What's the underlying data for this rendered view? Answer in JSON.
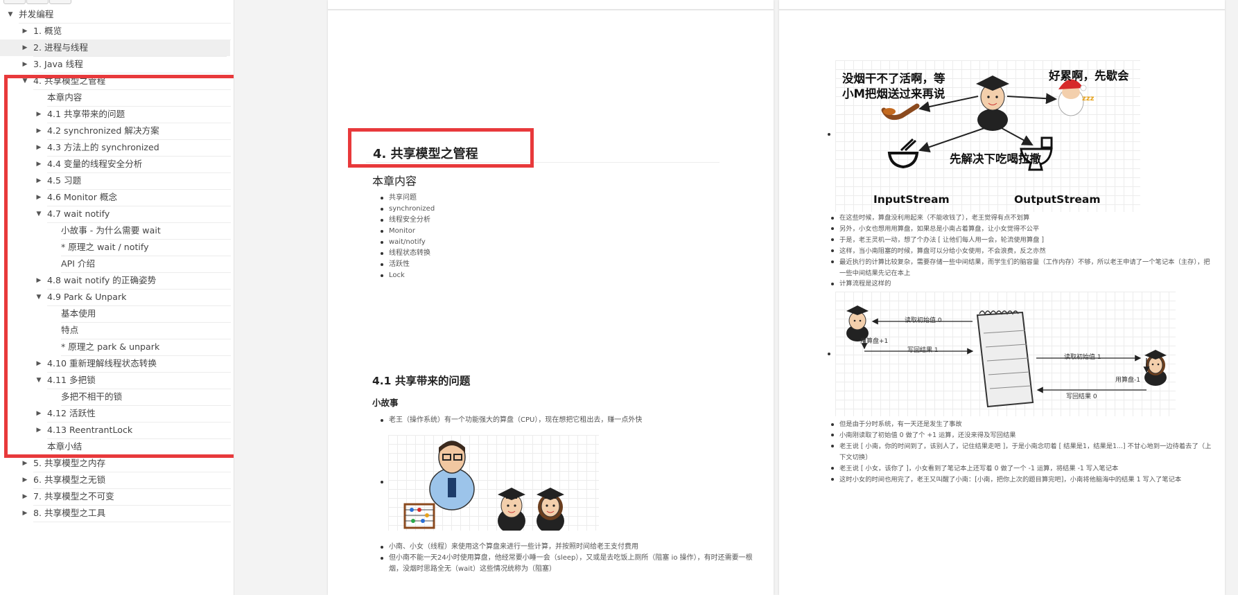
{
  "sidebar": {
    "items": [
      {
        "label": "并发编程",
        "indent": 0,
        "toggle": "▼",
        "interactable": true
      },
      {
        "label": "1. 概览",
        "indent": 1,
        "toggle": "▶",
        "interactable": true
      },
      {
        "label": "2. 进程与线程",
        "indent": 1,
        "toggle": "▶",
        "interactable": true,
        "selected": true
      },
      {
        "label": "3. Java 线程",
        "indent": 1,
        "toggle": "▶",
        "interactable": true
      },
      {
        "label": "4. 共享模型之管程",
        "indent": 1,
        "toggle": "▼",
        "interactable": true
      },
      {
        "label": "本章内容",
        "indent": 2,
        "toggle": "",
        "interactable": true
      },
      {
        "label": "4.1 共享带来的问题",
        "indent": 2,
        "toggle": "▶",
        "interactable": true
      },
      {
        "label": "4.2 synchronized 解决方案",
        "indent": 2,
        "toggle": "▶",
        "interactable": true
      },
      {
        "label": "4.3 方法上的 synchronized",
        "indent": 2,
        "toggle": "▶",
        "interactable": true
      },
      {
        "label": "4.4 变量的线程安全分析",
        "indent": 2,
        "toggle": "▶",
        "interactable": true
      },
      {
        "label": "4.5 习题",
        "indent": 2,
        "toggle": "▶",
        "interactable": true
      },
      {
        "label": "4.6 Monitor 概念",
        "indent": 2,
        "toggle": "▶",
        "interactable": true
      },
      {
        "label": "4.7 wait notify",
        "indent": 2,
        "toggle": "▼",
        "interactable": true
      },
      {
        "label": "小故事 - 为什么需要 wait",
        "indent": 3,
        "toggle": "",
        "interactable": true
      },
      {
        "label": "* 原理之 wait / notify",
        "indent": 3,
        "toggle": "",
        "interactable": true
      },
      {
        "label": "API 介绍",
        "indent": 3,
        "toggle": "",
        "interactable": true
      },
      {
        "label": "4.8 wait notify 的正确姿势",
        "indent": 2,
        "toggle": "▶",
        "interactable": true
      },
      {
        "label": "4.9 Park & Unpark",
        "indent": 2,
        "toggle": "▼",
        "interactable": true
      },
      {
        "label": "基本使用",
        "indent": 3,
        "toggle": "",
        "interactable": true
      },
      {
        "label": "特点",
        "indent": 3,
        "toggle": "",
        "interactable": true
      },
      {
        "label": "* 原理之 park & unpark",
        "indent": 3,
        "toggle": "",
        "interactable": true
      },
      {
        "label": "4.10 重新理解线程状态转换",
        "indent": 2,
        "toggle": "▶",
        "interactable": true
      },
      {
        "label": "4.11 多把锁",
        "indent": 2,
        "toggle": "▼",
        "interactable": true
      },
      {
        "label": "多把不相干的锁",
        "indent": 3,
        "toggle": "",
        "interactable": true
      },
      {
        "label": "4.12 活跃性",
        "indent": 2,
        "toggle": "▶",
        "interactable": true
      },
      {
        "label": "4.13 ReentrantLock",
        "indent": 2,
        "toggle": "▶",
        "interactable": true
      },
      {
        "label": "本章小结",
        "indent": 2,
        "toggle": "",
        "interactable": true
      },
      {
        "label": "5. 共享模型之内存",
        "indent": 1,
        "toggle": "▶",
        "interactable": true
      },
      {
        "label": "6. 共享模型之无锁",
        "indent": 1,
        "toggle": "▶",
        "interactable": true
      },
      {
        "label": "7. 共享模型之不可变",
        "indent": 1,
        "toggle": "▶",
        "interactable": true
      },
      {
        "label": "8. 共享模型之工具",
        "indent": 1,
        "toggle": "▶",
        "interactable": true
      }
    ]
  },
  "colors": {
    "highlight_box": "#e8393b",
    "selected_row": "#efefef"
  },
  "page1": {
    "chapter_title": "4. 共享模型之管程",
    "contents_heading": "本章内容",
    "contents": [
      "共享问题",
      "synchronized",
      "线程安全分析",
      "Monitor",
      "wait/notify",
      "线程状态转换",
      "活跃性",
      "Lock"
    ],
    "section_title": "4.1 共享带来的问题",
    "story_heading": "小故事",
    "bullet1": "老王（操作系统）有一个功能强大的算盘（CPU），现在想把它租出去，赚一点外快",
    "bullets_after": [
      "小南、小女（线程）来使用这个算盘来进行一些计算，并按照时间给老王支付费用",
      "但小南不能一天24小时使用算盘，他经常要小睡一会（sleep），又或是去吃饭上厕所（阻塞 io 操作），有时还需要一根烟，没烟时思路全无（wait）这些情况统称为（阻塞）"
    ],
    "figure_icons": [
      "abacus-icon",
      "boss-icon",
      "student-boy-icon",
      "student-girl-icon"
    ]
  },
  "page2": {
    "figure1": {
      "text_left": "没烟干不了活啊，等\n小M把烟送过来再说",
      "text_right": "好累啊，先歇会",
      "text_mid": "先解决下吃喝拉撒",
      "label_in": "InputStream",
      "label_out": "OutputStream",
      "icons": [
        "pipe-icon",
        "student-icon",
        "sleeping-santa-icon",
        "bowl-icon",
        "toilet-icon"
      ]
    },
    "bullets1": [
      "在这些时候，算盘没利用起来（不能收钱了），老王觉得有点不划算",
      "另外，小女也想用用算盘，如果总是小南占着算盘，让小女觉得不公平",
      "于是，老王灵机一动，想了个办法 [ 让他们每人用一会，轮流使用算盘 ]",
      "这样，当小南阻塞的时候，算盘可以分给小女使用，不会浪费，反之亦然",
      "最近执行的计算比较复杂，需要存储一些中间结果，而学生们的脑容量（工作内存）不够，所以老王申请了一个笔记本（主存），把一些中间结果先记在本上",
      "计算流程是这样的"
    ],
    "figure2": {
      "read_init_left": "读取初始值 0",
      "add_one": "用算盘+1",
      "write_back_left": "写回结果 1",
      "read_init_right": "读取初始值 1",
      "sub_one": "用算盘-1",
      "write_back_right": "写回结果 0",
      "icons": [
        "student-boy-icon",
        "notebook-icon",
        "student-girl-icon"
      ]
    },
    "bullets2": [
      "但是由于分时系统，有一天还是发生了事故",
      "小南刚读取了初始值 0 做了个 +1 运算，还没来得及写回结果",
      "老王说 [ 小南，你的时间到了，该别人了，记住结果走吧 ]，于是小南念叨着 [ 结果是1，结果是1...] 不甘心地到一边待着去了（上下文切换）",
      "老王说 [ 小女，该你了 ]，小女看到了笔记本上还写着 0 做了一个 -1 运算，将结果 -1 写入笔记本",
      "这时小女的时间也用完了，老王又叫醒了小南：[小南，把你上次的题目算完吧]，小南将他脑海中的结果 1 写入了笔记本"
    ]
  }
}
